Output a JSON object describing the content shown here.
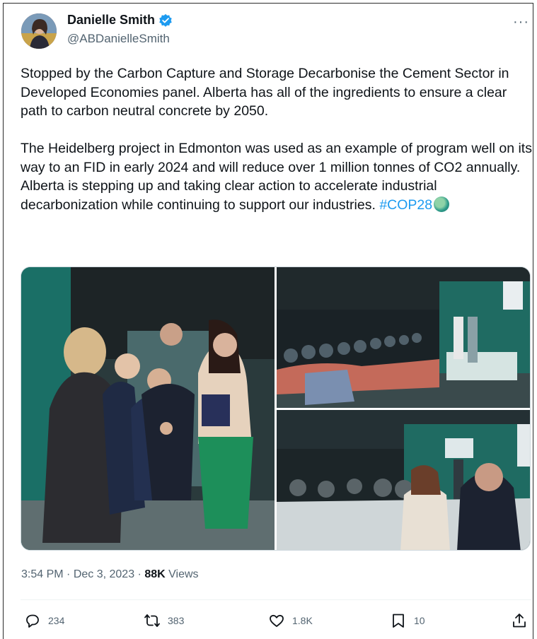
{
  "author": {
    "name": "Danielle Smith",
    "handle": "@ABDanielleSmith",
    "verified_color": "#1d9bf0"
  },
  "more_label": "···",
  "post": {
    "paragraph1": "Stopped by the Carbon Capture and Storage Decarbonise the Cement Sector in Developed Economies panel. Alberta has all of the ingredients to ensure a clear path to carbon neutral concrete by 2050.",
    "paragraph2": "The Heidelberg project in Edmonton was used as an example of program well on its way to an FID in early 2024 and will reduce over 1 million tonnes of CO2 annually.  Alberta is stepping up and taking clear action to accelerate industrial decarbonization while continuing to support our industries. ",
    "hashtag": "#COP28"
  },
  "meta": {
    "time": "3:54 PM",
    "date": "Dec 3, 2023",
    "views_count": "88K",
    "views_label": "Views",
    "separator": " · "
  },
  "actions": {
    "replies": "234",
    "reposts": "383",
    "likes": "1.8K",
    "bookmarks": "10"
  },
  "icons": [
    "verified-badge-icon",
    "more-icon",
    "reply-icon",
    "repost-icon",
    "like-icon",
    "bookmark-icon",
    "share-icon"
  ]
}
